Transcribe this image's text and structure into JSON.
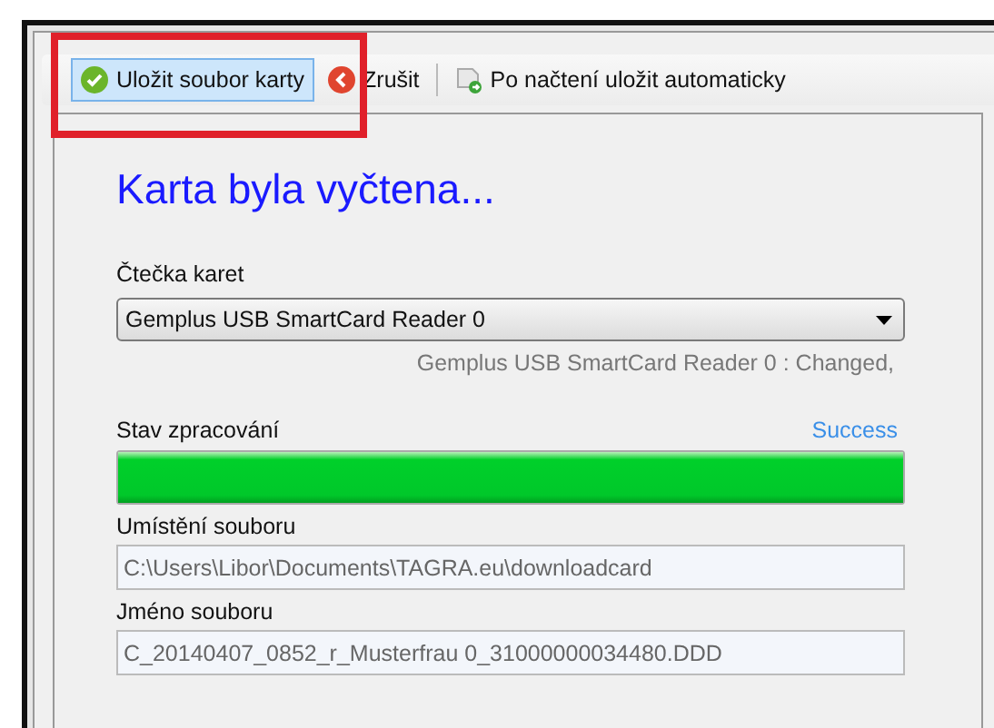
{
  "toolbar": [
    {
      "kind": "save",
      "label": "Uložit soubor karty",
      "selected": true
    },
    {
      "kind": "cancel",
      "label": "Zrušit",
      "selected": false
    },
    {
      "kind": "auto",
      "label": "Po načtení uložit automaticky",
      "selected": false
    }
  ],
  "heading": "Karta byla vyčtena...",
  "reader": {
    "label": "Čtečka karet",
    "value": "Gemplus USB SmartCard Reader 0",
    "status": "Gemplus USB SmartCard Reader 0 : Changed,"
  },
  "progress": {
    "label": "Stav zpracování",
    "result": "Success",
    "level": 1
  },
  "location": {
    "label": "Umístění souboru",
    "value": "C:\\Users\\Libor\\Documents\\TAGRA.eu\\downloadcard"
  },
  "filename": {
    "label": "Jméno souboru",
    "value": "C_20140407_0852_r_Musterfrau 0_31000000034480.DDD"
  }
}
